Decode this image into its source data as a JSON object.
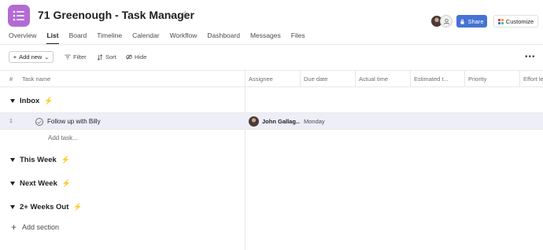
{
  "project": {
    "title": "71 Greenough - Task Manager",
    "icon": "list-icon",
    "icon_color": "#b36bd4"
  },
  "header": {
    "share_label": "Share",
    "customize_label": "Customize",
    "share_color": "#4573d2"
  },
  "tabs": [
    {
      "label": "Overview"
    },
    {
      "label": "List"
    },
    {
      "label": "Board"
    },
    {
      "label": "Timeline"
    },
    {
      "label": "Calendar"
    },
    {
      "label": "Workflow"
    },
    {
      "label": "Dashboard"
    },
    {
      "label": "Messages"
    },
    {
      "label": "Files"
    }
  ],
  "active_tab": "List",
  "toolbar": {
    "add_new_label": "Add new",
    "filter_label": "Filter",
    "sort_label": "Sort",
    "hide_label": "Hide"
  },
  "columns": {
    "num": "#",
    "task_name": "Task name",
    "assignee": "Assignee",
    "due_date": "Due date",
    "actual_time": "Actual time",
    "estimated_time": "Estimated t...",
    "priority": "Priority",
    "effort": "Effort le"
  },
  "sections": [
    {
      "label": "Inbox",
      "bolt": "⚡"
    },
    {
      "label": "This Week",
      "bolt": "⚡"
    },
    {
      "label": "Next Week",
      "bolt": "⚡"
    },
    {
      "label": "2+ Weeks Out",
      "bolt": "⚡"
    }
  ],
  "tasks": [
    {
      "num": "1",
      "name": "Follow up with Billy",
      "assignee": "John Gallag...",
      "due": "Monday"
    }
  ],
  "add_task_label": "Add task...",
  "add_section_label": "Add section"
}
